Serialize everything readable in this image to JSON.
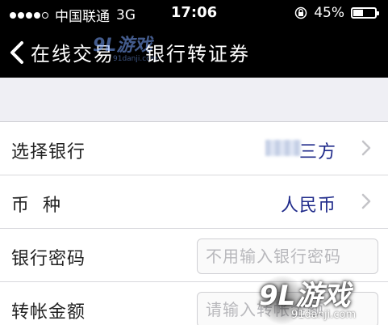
{
  "status_bar": {
    "carrier": "中国联通",
    "network": "3G",
    "time": "17:06",
    "battery_percent": "45%",
    "battery_level": 0.45,
    "signal_dots_filled": 4,
    "signal_dots_total": 5
  },
  "nav_bar": {
    "back_label": "在线交易",
    "title": "银行转证券"
  },
  "form": {
    "rows": [
      {
        "label": "选择银行",
        "value": "三方"
      },
      {
        "label": "币  种",
        "value": "人民币"
      },
      {
        "label": "银行密码",
        "placeholder": "不用输入银行密码"
      },
      {
        "label": "转帐金额",
        "placeholder": "请输入转帐金额"
      }
    ]
  },
  "watermark": {
    "top_logo": "9L游戏",
    "top_url": "91danji.com",
    "bottom_logo": "9L游戏",
    "bottom_url": "91danji.com"
  },
  "colors": {
    "bar_background": "#000000",
    "value_text": "#1f2a8a",
    "page_background": "#efeff4"
  }
}
